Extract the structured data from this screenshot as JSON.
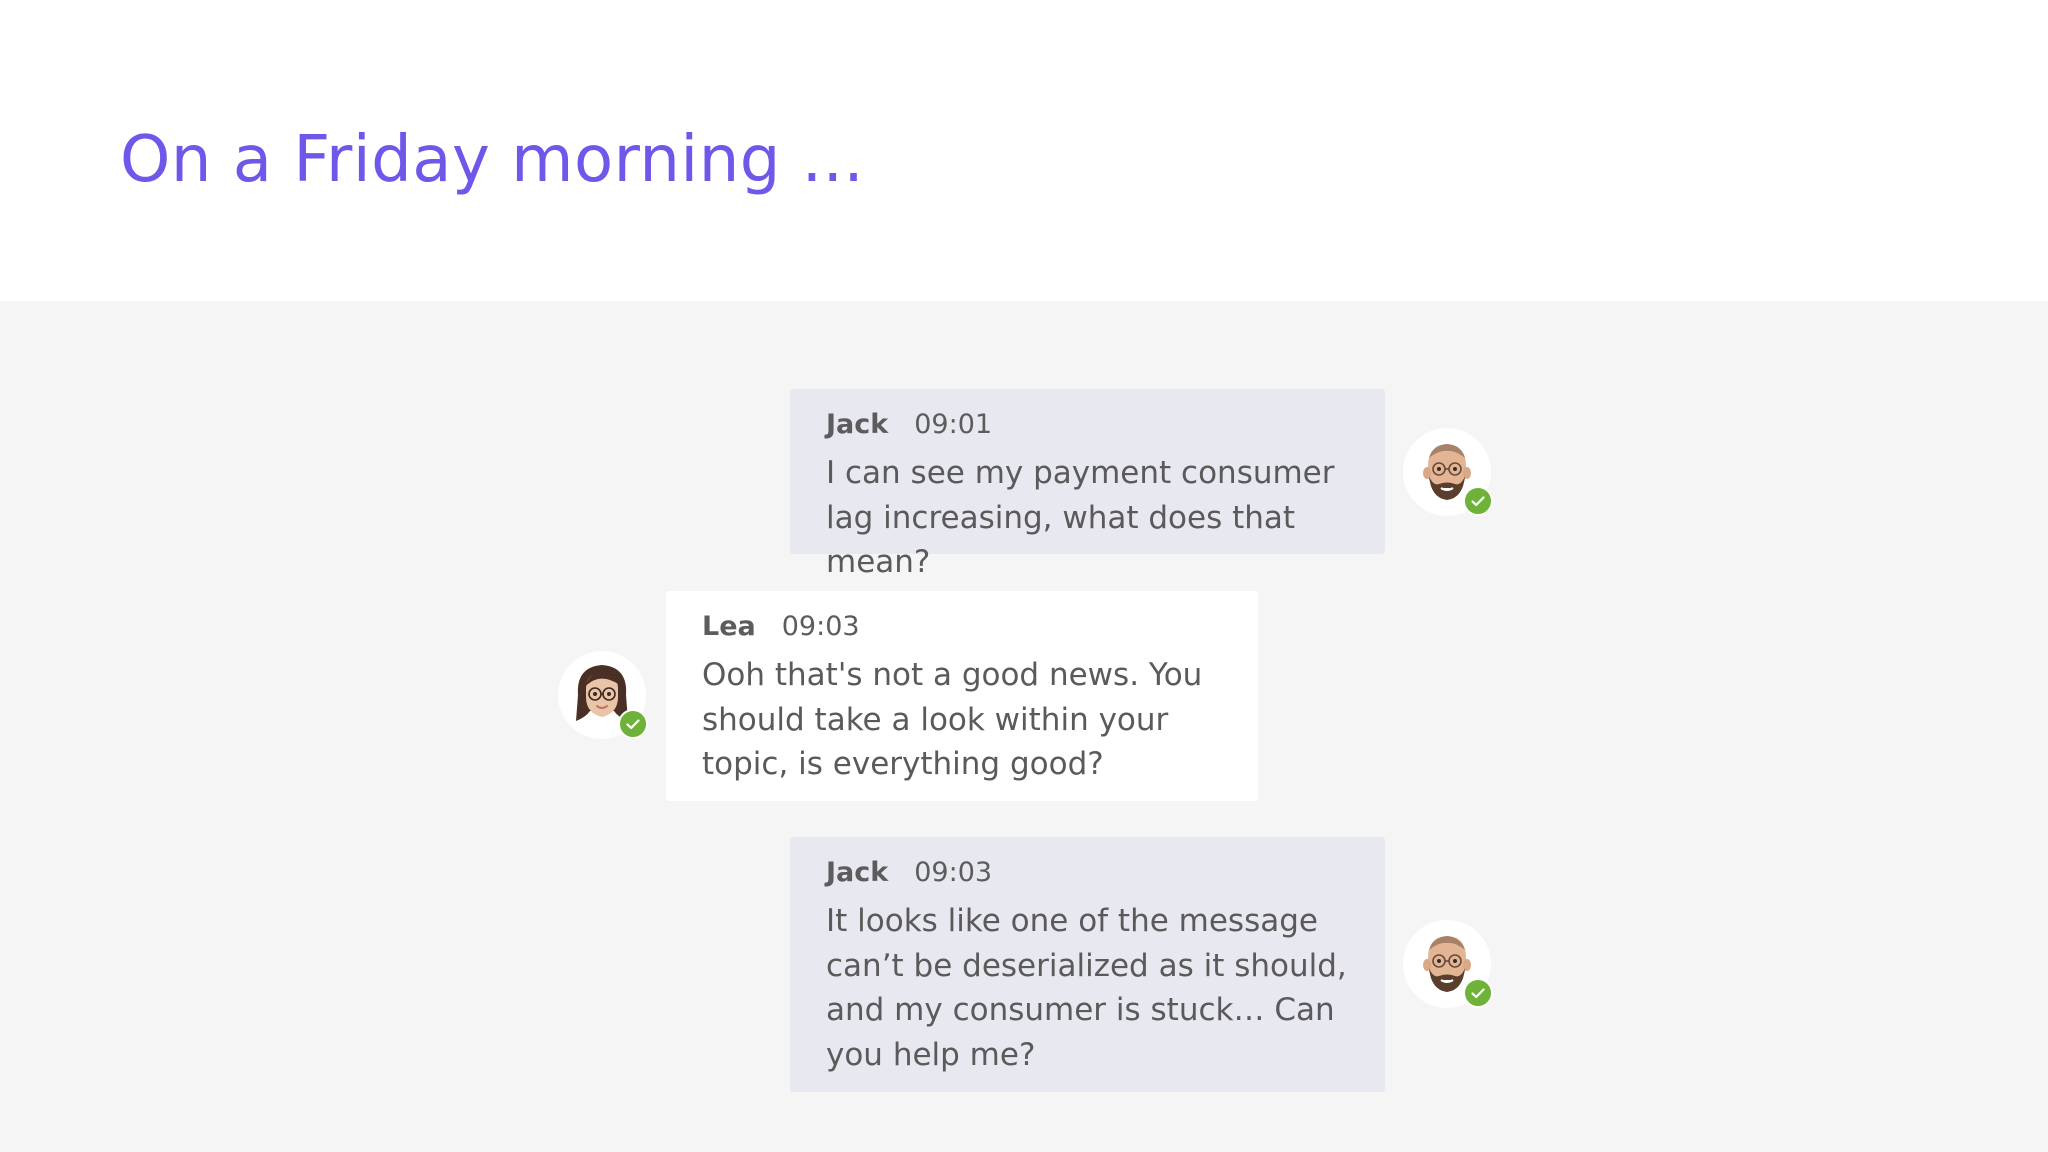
{
  "slide": {
    "title": "On a Friday morning ..."
  },
  "chat": {
    "messages": [
      {
        "author": "Jack",
        "time": "09:01",
        "text": "I can see my payment consumer lag increasing, what does that mean?",
        "side": "right",
        "avatar_icon": "male-memoji-avatar-icon",
        "status": "available"
      },
      {
        "author": "Lea",
        "time": "09:03",
        "text": "Ooh that's not a good news. You should take a look within your topic, is everything good?",
        "side": "left",
        "avatar_icon": "female-memoji-avatar-icon",
        "status": "available"
      },
      {
        "author": "Jack",
        "time": "09:03",
        "text": "It looks like one of the message can’t be deserialized as it should, and my consumer is stuck… Can you help me?",
        "side": "right",
        "avatar_icon": "male-memoji-avatar-icon",
        "status": "available"
      }
    ]
  },
  "colors": {
    "title": "#7156ea",
    "chat_background": "#f5f5f5",
    "self_bubble": "#e8e8f0",
    "other_bubble": "#ffffff",
    "status_badge": "#6fb23a",
    "text": "#5a5a5a"
  }
}
